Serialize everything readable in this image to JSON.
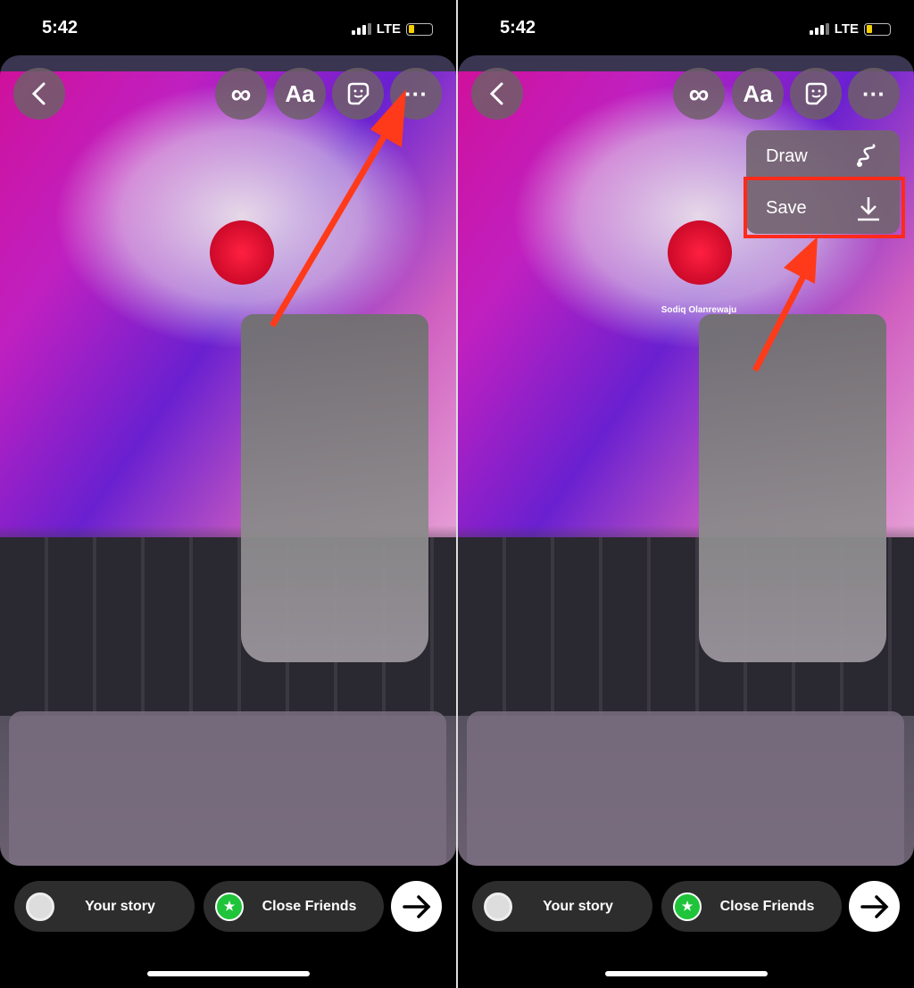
{
  "panels": [
    {
      "status": {
        "time": "5:42",
        "network": "LTE",
        "battery_level": 0.25
      },
      "photo_text": {
        "username": ""
      },
      "toolbar": {
        "back_icon": "chevron-left",
        "buttons": [
          {
            "icon": "infinity-boomerang",
            "label": "∞"
          },
          {
            "icon": "text",
            "label": "Aa"
          },
          {
            "icon": "sticker"
          },
          {
            "icon": "more-horizontal",
            "label": "···"
          }
        ]
      },
      "bottom": {
        "your_story": "Your story",
        "close_friends": "Close Friends",
        "send_icon": "arrow-right"
      }
    },
    {
      "status": {
        "time": "5:42",
        "network": "LTE",
        "battery_level": 0.25
      },
      "photo_text": {
        "username": "Sodiq Olanrewaju"
      },
      "toolbar": {
        "back_icon": "chevron-left",
        "buttons": [
          {
            "icon": "infinity-boomerang",
            "label": "∞"
          },
          {
            "icon": "text",
            "label": "Aa"
          },
          {
            "icon": "sticker"
          },
          {
            "icon": "more-horizontal",
            "label": "···"
          }
        ]
      },
      "menu": {
        "items": [
          {
            "label": "Draw",
            "icon": "squiggle-draw"
          },
          {
            "label": "Save",
            "icon": "download"
          }
        ]
      },
      "bottom": {
        "your_story": "Your story",
        "close_friends": "Close Friends",
        "send_icon": "arrow-right"
      }
    }
  ],
  "colors": {
    "annotation_red": "#ff2a1a",
    "close_friends_green": "#1fc43a",
    "battery_yellow": "#f5d000"
  }
}
